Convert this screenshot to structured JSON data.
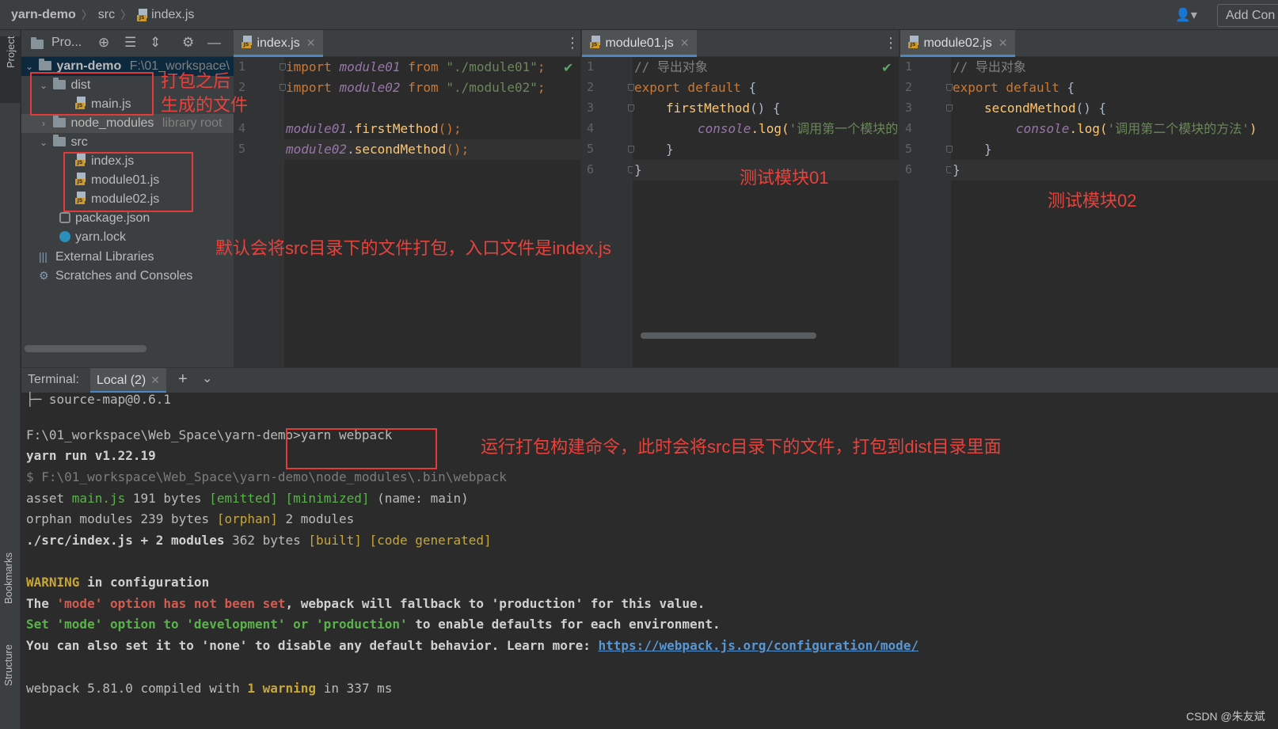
{
  "navbar": {
    "project": "yarn-demo",
    "folder": "src",
    "file": "index.js",
    "add_config": "Add Con"
  },
  "left_strip": {
    "project_tab": "Project",
    "bookmarks_tab": "Bookmarks",
    "structure_tab": "Structure"
  },
  "project_panel": {
    "title": "Pro...",
    "tree": {
      "root_name": "yarn-demo",
      "root_path": "F:\\01_workspace\\",
      "dist": "dist",
      "main_js": "main.js",
      "node_modules": "node_modules",
      "node_modules_hint": "library root",
      "src": "src",
      "index_js": "index.js",
      "module01_js": "module01.js",
      "module02_js": "module02.js",
      "package_json": "package.json",
      "yarn_lock": "yarn.lock",
      "external_libraries": "External Libraries",
      "scratches": "Scratches and Consoles"
    }
  },
  "editors": {
    "index": {
      "tab": "index.js",
      "line_numbers": [
        "1",
        "2",
        "4",
        "5"
      ],
      "l1": {
        "kw": "import",
        "id": "module01",
        "from": "from",
        "str": "\"./module01\"",
        "end": ";"
      },
      "l2": {
        "kw": "import",
        "id": "module02",
        "from": "from",
        "str": "\"./module02\"",
        "end": ";"
      },
      "l4": {
        "id": "module01",
        "dot": ".",
        "fn": "firstMethod",
        "end": "();"
      },
      "l5": {
        "id": "module02",
        "dot": ".",
        "fn": "secondMethod",
        "end": "();"
      }
    },
    "module01": {
      "tab": "module01.js",
      "line_numbers": [
        "1",
        "2",
        "3",
        "4",
        "5",
        "6"
      ],
      "l1": "// 导出对象",
      "l2_kw": "export default",
      "l2_rest": " {",
      "l3_fn": "firstMethod",
      "l3_rest": "() {",
      "l4_obj": "console",
      "l4_fn": ".log(",
      "l4_str": "'调用第一个模块的",
      "l5": "}",
      "l6": "}"
    },
    "module02": {
      "tab": "module02.js",
      "line_numbers": [
        "1",
        "2",
        "3",
        "4",
        "5",
        "6"
      ],
      "l1": "// 导出对象",
      "l2_kw": "export default",
      "l2_rest": " {",
      "l3_fn": "secondMethod",
      "l3_rest": "() {",
      "l4_obj": "console",
      "l4_fn": ".log(",
      "l4_str": "'调用第二个模块的方法'",
      "l4_end": ")",
      "l5": "}",
      "l6": "}"
    }
  },
  "terminal": {
    "label": "Terminal:",
    "tab": "Local (2)",
    "lines": {
      "l1": "├─ source-map@0.6.1",
      "l2": "F:\\01_workspace\\Web_Space\\yarn-demo>yarn webpack",
      "l3": "yarn run v1.22.19",
      "l4": "$ F:\\01_workspace\\Web_Space\\yarn-demo\\node_modules\\.bin\\webpack",
      "l5_a": "asset ",
      "l5_b": "main.js",
      "l5_c": " 191 bytes ",
      "l5_d": "[emitted] [minimized]",
      "l5_e": " (name: main)",
      "l6_a": "orphan modules 239 bytes ",
      "l6_b": "[orphan]",
      "l6_c": " 2 modules",
      "l7_a": "./src/index.js + 2 modules",
      "l7_b": " 362 bytes ",
      "l7_c": "[built] [code generated]",
      "l8_a": "WARNING",
      "l8_b": " in configuration",
      "l9_a": "The ",
      "l9_b": "'mode' option has not been set",
      "l9_c": ", webpack will fallback to 'production' for this value.",
      "l10": "Set 'mode' option to 'development' or 'production'",
      "l10_b": " to enable defaults for each environment.",
      "l11_a": "You can also set it to 'none' to disable any default behavior. Learn more: ",
      "l11_link": "https://webpack.js.org/configuration/mode/",
      "l12_a": "webpack 5.81.0 compiled with ",
      "l12_b": "1 warning",
      "l12_c": " in 337 ms"
    }
  },
  "annotations": {
    "dist_note_1": "打包之后",
    "dist_note_2": "生成的文件",
    "src_note": "默认会将src目录下的文件打包，入口文件是index.js",
    "module01_note": "测试模块01",
    "module02_note": "测试模块02",
    "command_note": "运行打包构建命令，此时会将src目录下的文件，打包到dist目录里面"
  },
  "watermark": "CSDN @朱友斌",
  "colors": {
    "annotation_red": "#e43a3a",
    "keyword": "#cc7832",
    "string": "#6a8759",
    "function": "#ffc66d",
    "identifier": "#9876aa",
    "tab_underline": "#4a88c7"
  }
}
